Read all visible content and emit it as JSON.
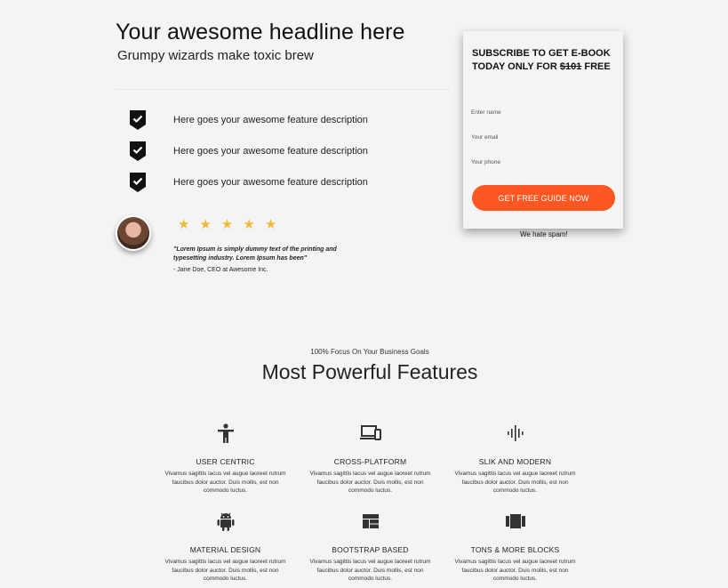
{
  "hero": {
    "headline": "Your awesome headline here",
    "subheadline": "Grumpy wizards make toxic brew"
  },
  "features": [
    {
      "icon": "shield-check-icon",
      "text": "Here goes your awesome feature description"
    },
    {
      "icon": "shield-check-icon",
      "text": "Here goes your awesome feature description"
    },
    {
      "icon": "shield-check-icon",
      "text": "Here goes your awesome feature description"
    }
  ],
  "testimonial": {
    "rating": 5,
    "stars": [
      "★",
      "★",
      "★",
      "★",
      "★"
    ],
    "quote": "\"Lorem Ipsum is simply dummy text of the printing and typesetting industry. Lorem Ipsum has been\"",
    "author": "- Jane Doe, CEO at Awesome Inc."
  },
  "subscribe": {
    "title_prefix": "SUBSCRIBE TO GET E-BOOK TODAY ONLY FOR ",
    "old_price": "$101",
    "title_suffix": " FREE",
    "name_placeholder": "Enter name",
    "email_placeholder": "Your email",
    "phone_placeholder": "Your phone",
    "button_label": "GET FREE GUIDE NOW",
    "spam_note": "We hate spam!"
  },
  "features_section": {
    "eyebrow": "100% Focus On Your Business Goals",
    "title": "Most Powerful Features",
    "cards": [
      {
        "icon": "accessibility-icon",
        "title": "USER CENTRIC",
        "desc": "Vivamus sagittis lacus vel augue laoreet rutrum faucibus dolor auctor. Duis mollis, est non commodo luctus."
      },
      {
        "icon": "devices-icon",
        "title": "CROSS-PLATFORM",
        "desc": "Vivamus sagittis lacus vel augue laoreet rutrum faucibus dolor auctor. Duis mollis, est non commodo luctus."
      },
      {
        "icon": "soundwave-icon",
        "title": "SLIK AND MODERN",
        "desc": "Vivamus sagittis lacus vel augue laoreet rutrum faucibus dolor auctor. Duis mollis, est non commodo luctus."
      },
      {
        "icon": "android-icon",
        "title": "MATERIAL DESIGN",
        "desc": "Vivamus sagittis lacus vel augue laoreet rutrum faucibus dolor auctor. Duis mollis, est non commodo luctus."
      },
      {
        "icon": "dashboard-grid-icon",
        "title": "BOOTSTRAP BASED",
        "desc": "Vivamus sagittis lacus vel augue laoreet rutrum faucibus dolor auctor. Duis mollis, est non commodo luctus."
      },
      {
        "icon": "blocks-icon",
        "title": "TONS & MORE BLOCKS",
        "desc": "Vivamus sagittis lacus vel augue laoreet rutrum faucibus dolor auctor. Duis mollis, est non commodo luctus."
      }
    ]
  },
  "colors": {
    "accent": "#ff5722",
    "star": "#f0b93a",
    "background": "#f4f4f4"
  }
}
